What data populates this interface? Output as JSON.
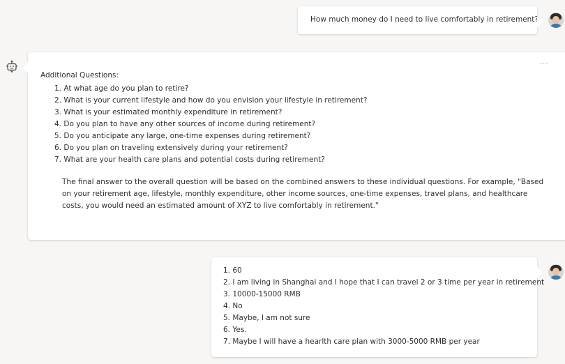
{
  "conversation": [
    {
      "role": "user",
      "text": "How much money do I need to live comfortably in retirement?"
    },
    {
      "role": "bot",
      "more_label": "...",
      "heading": "Additional Questions:",
      "questions": [
        "1. At what age do you plan to retire?",
        "2. What is your current lifestyle and how do you envision your lifestyle in retirement?",
        "3. What is your estimated monthly expenditure in retirement?",
        "4. Do you plan to have any other sources of income during retirement?",
        "5. Do you anticipate any large, one-time expenses during retirement?",
        "6. Do you plan on traveling extensively during your retirement?",
        "7. What are your health care plans and potential costs during retirement?"
      ],
      "final": "The final answer to the overall question will be based on the combined answers to these individual questions. For example, \"Based on your retirement age, lifestyle, monthly expenditure, other income sources, one-time expenses, travel plans, and healthcare costs, you would need an estimated amount of XYZ to live comfortably in retirement.\""
    },
    {
      "role": "user",
      "answers": [
        "1. 60",
        "2. I am living in Shanghai and I hope that I can travel 2 or 3 time per year in retirement",
        "3. 10000-15000 RMB",
        "4. No",
        "5. Maybe, I am not sure",
        "6. Yes.",
        "7. Maybe I will have a hearlth care plan with 3000-5000 RMB per year"
      ]
    }
  ],
  "icons": {
    "bot": "bot-icon",
    "user_avatar": "avatar"
  },
  "colors": {
    "background": "#f7f6f5",
    "bubble": "#ffffff",
    "text": "#2f2f2f",
    "muted": "#9a9a9a"
  }
}
